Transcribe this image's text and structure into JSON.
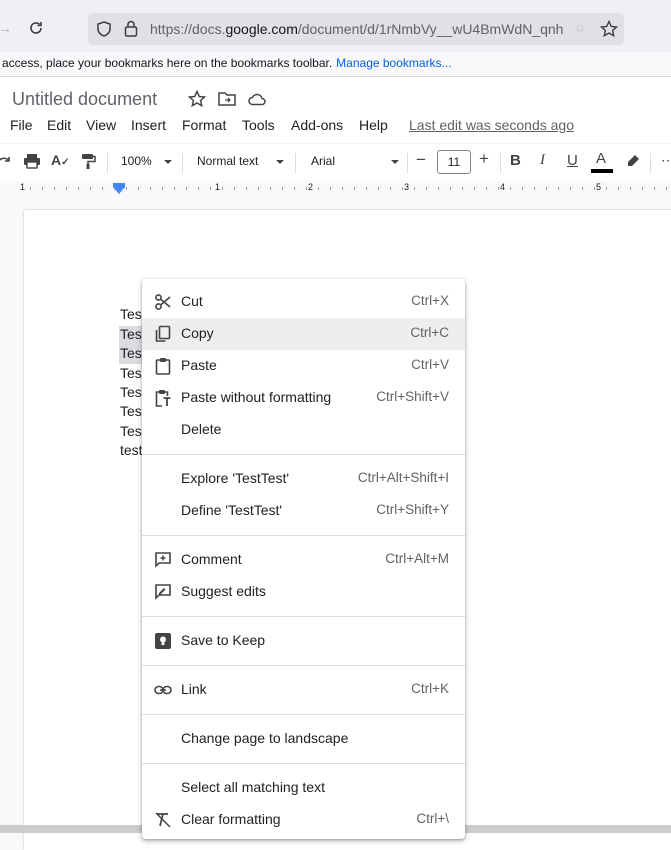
{
  "browser": {
    "url_prefix": "https://docs.",
    "url_domain": "google.com",
    "url_rest": "/document/d/1rNmbVy__wU4BmWdN_qnh",
    "bookmarks_text": "access, place your bookmarks here on the bookmarks toolbar.",
    "bookmarks_link": "Manage bookmarks..."
  },
  "doc": {
    "title": "Untitled document",
    "menus": [
      "File",
      "Edit",
      "View",
      "Insert",
      "Format",
      "Tools",
      "Add-ons",
      "Help"
    ],
    "last_edit": "Last edit was seconds ago"
  },
  "toolbar": {
    "zoom": "100%",
    "style": "Normal text",
    "font": "Arial",
    "font_size": "11",
    "bold": "B",
    "italic": "I",
    "underline": "U",
    "text_color_letter": "A"
  },
  "ruler": {
    "marks": [
      "1",
      "1",
      "2",
      "3",
      "4",
      "5"
    ]
  },
  "body_lines": [
    "Tes",
    "Tes",
    "Tes",
    "Tes",
    "Tes",
    "Tes",
    "Tes",
    "test"
  ],
  "context_menu": {
    "items": [
      {
        "label": "Cut",
        "shortcut": "Ctrl+X",
        "icon": "scissors-icon"
      },
      {
        "label": "Copy",
        "shortcut": "Ctrl+C",
        "icon": "copy-icon"
      },
      {
        "label": "Paste",
        "shortcut": "Ctrl+V",
        "icon": "paste-icon"
      },
      {
        "label": "Paste without formatting",
        "shortcut": "Ctrl+Shift+V",
        "icon": "paste-plain-icon"
      },
      {
        "label": "Delete",
        "shortcut": "",
        "icon": ""
      },
      {
        "label": "Explore 'TestTest'",
        "shortcut": "Ctrl+Alt+Shift+I",
        "icon": ""
      },
      {
        "label": "Define 'TestTest'",
        "shortcut": "Ctrl+Shift+Y",
        "icon": ""
      },
      {
        "label": "Comment",
        "shortcut": "Ctrl+Alt+M",
        "icon": "comment-icon"
      },
      {
        "label": "Suggest edits",
        "shortcut": "",
        "icon": "suggest-edits-icon"
      },
      {
        "label": "Save to Keep",
        "shortcut": "",
        "icon": "keep-icon"
      },
      {
        "label": "Link",
        "shortcut": "Ctrl+K",
        "icon": "link-icon"
      },
      {
        "label": "Change page to landscape",
        "shortcut": "",
        "icon": ""
      },
      {
        "label": "Select all matching text",
        "shortcut": "",
        "icon": ""
      },
      {
        "label": "Clear formatting",
        "shortcut": "Ctrl+\\",
        "icon": "clear-formatting-icon"
      }
    ]
  },
  "colors": {
    "accent": "#1a73e8",
    "text_color_bar": "#000000"
  }
}
